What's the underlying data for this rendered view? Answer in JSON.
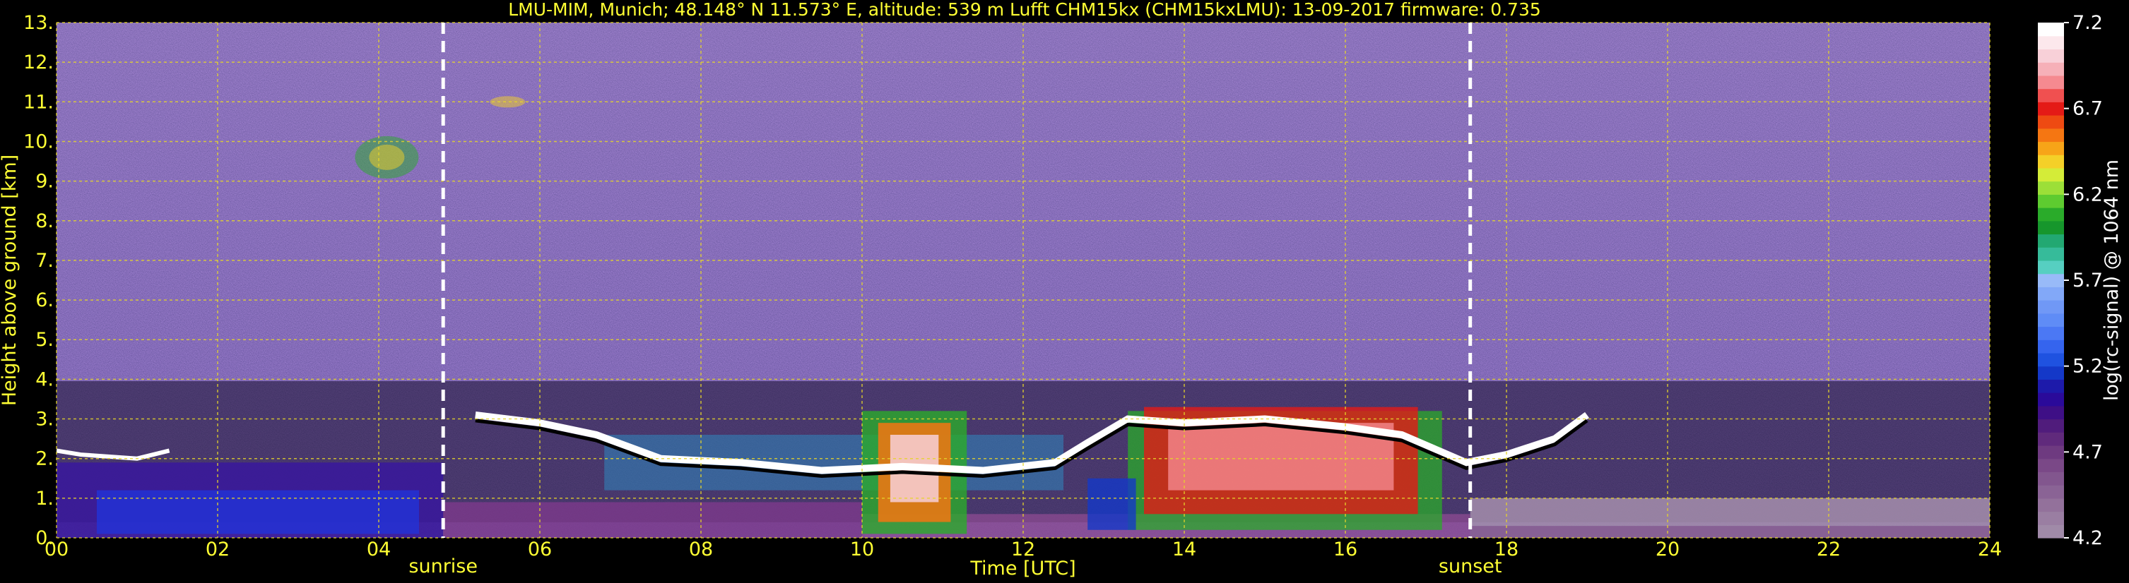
{
  "title": "LMU-MIM, Munich; 48.148° N 11.573° E, altitude: 539 m    Lufft CHM15kx (CHM15kxLMU): 13-09-2017    firmware: 0.735",
  "chart_data": {
    "type": "heatmap",
    "title": "LMU-MIM, Munich; 48.148° N 11.573° E, altitude: 539 m    Lufft CHM15kx (CHM15kxLMU): 13-09-2017    firmware: 0.735",
    "xlabel": "Time [UTC]",
    "ylabel": "Height above ground [km]",
    "xlim": [
      0,
      24
    ],
    "ylim": [
      0,
      13
    ],
    "x_ticks": [
      "00",
      "02",
      "04",
      "06",
      "08",
      "10",
      "12",
      "14",
      "16",
      "18",
      "20",
      "22",
      "24"
    ],
    "y_ticks": [
      "0.",
      "1.",
      "2.",
      "3.",
      "4.",
      "5.",
      "6.",
      "7.",
      "8.",
      "9.",
      "10.",
      "11.",
      "12.",
      "13."
    ],
    "grid": true,
    "colorbar": {
      "label": "log(rc-signal) @ 1064 nm",
      "range": [
        4.2,
        7.2
      ],
      "ticks": [
        "4.2",
        "4.7",
        "5.2",
        "5.7",
        "6.2",
        "6.7",
        "7.2"
      ],
      "colors": [
        "#a08aa8",
        "#9a7ea2",
        "#93719b",
        "#8a6395",
        "#82568e",
        "#7a4887",
        "#6e3a80",
        "#602a7c",
        "#501c7c",
        "#3e0f86",
        "#2a0a9a",
        "#1d1aaa",
        "#1438c8",
        "#1f52e0",
        "#3564ee",
        "#4b78f4",
        "#5f8cf6",
        "#7098f6",
        "#82a8f8",
        "#98baf8",
        "#56cfc1",
        "#36bb9a",
        "#22a872",
        "#16962c",
        "#2aab2a",
        "#5ecb30",
        "#9cdf38",
        "#d4ec38",
        "#f4d028",
        "#f7a418",
        "#f57612",
        "#ee4a12",
        "#e41a16",
        "#f05050",
        "#f58a90",
        "#f6b0b8",
        "#f8d0d8",
        "#fce8ec",
        "#ffffff"
      ]
    },
    "markers": [
      {
        "label": "sunrise",
        "x": 4.8
      },
      {
        "label": "sunset",
        "x": 17.55
      }
    ]
  }
}
